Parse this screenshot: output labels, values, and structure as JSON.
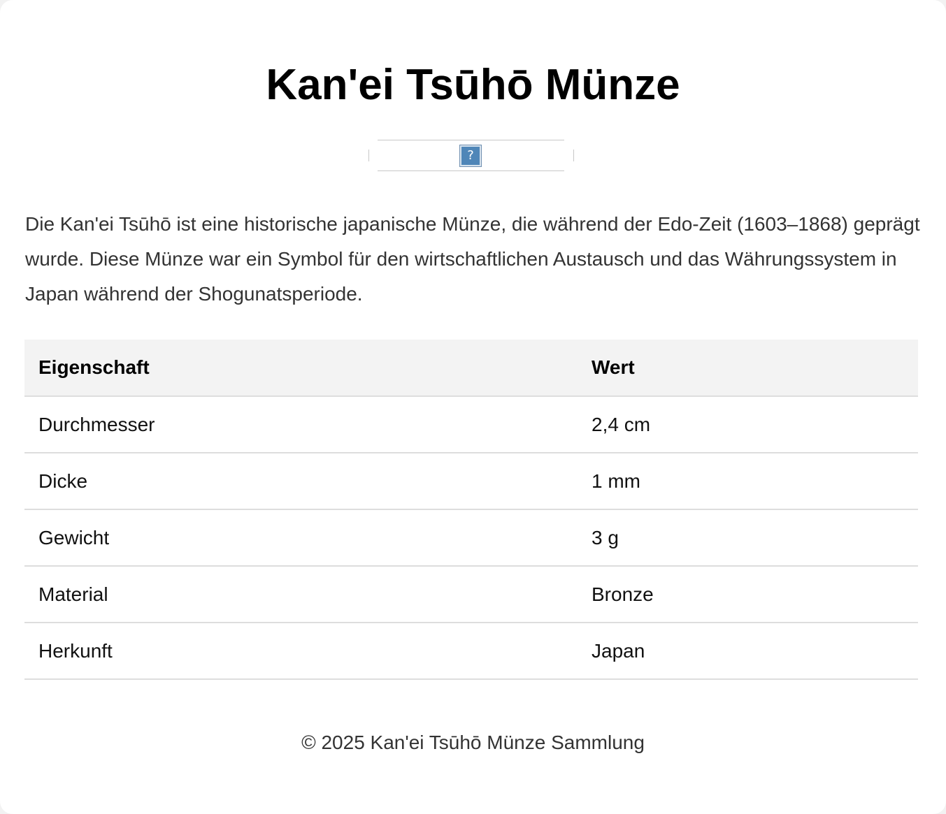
{
  "page": {
    "title": "Kan'ei Tsūhō Münze",
    "image": {
      "icon": "broken-image-icon",
      "glyph": "?"
    },
    "description": "Die Kan'ei Tsūhō ist eine historische japanische Münze, die während der Edo-Zeit (1603–1868) geprägt wurde. Diese Münze war ein Symbol für den wirtschaftlichen Austausch und das Währungssystem in Japan während der Shogunatsperiode.",
    "table": {
      "headers": [
        "Eigenschaft",
        "Wert"
      ],
      "rows": [
        [
          "Durchmesser",
          "2,4 cm"
        ],
        [
          "Dicke",
          "1 mm"
        ],
        [
          "Gewicht",
          "3 g"
        ],
        [
          "Material",
          "Bronze"
        ],
        [
          "Herkunft",
          "Japan"
        ]
      ]
    },
    "footer": "© 2025 Kan'ei Tsūhō Münze Sammlung"
  },
  "colors": {
    "background": "#ffffff",
    "header_row": "#f3f3f3",
    "text_body": "#333333",
    "divider": "#dddddd"
  }
}
